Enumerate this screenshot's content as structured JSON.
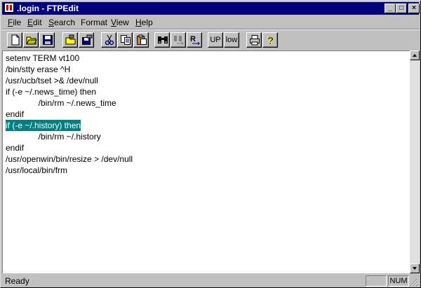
{
  "window": {
    "title": ".login - FTPEdit",
    "controls": {
      "minimize": "_",
      "maximize": "□",
      "close": "×"
    }
  },
  "menu": {
    "items": [
      {
        "accel": "F",
        "rest": "ile"
      },
      {
        "accel": "E",
        "rest": "dit"
      },
      {
        "accel": "S",
        "rest": "earch"
      },
      {
        "accel": "",
        "rest": "Format"
      },
      {
        "accel": "V",
        "rest": "iew"
      },
      {
        "accel": "H",
        "rest": "elp"
      }
    ]
  },
  "toolbar": {
    "icons": [
      "new-file-icon",
      "open-folder-icon",
      "save-disk-icon",
      "ftp-open-icon",
      "ftp-save-icon",
      "cut-icon",
      "copy-icon",
      "paste-icon",
      "find-binoculars-icon",
      "find-next-icon",
      "replace-icon",
      "print-icon",
      "help-icon"
    ],
    "up_label": "UP",
    "low_label": "low"
  },
  "editor": {
    "lines": [
      "setenv TERM vt100",
      "/bin/stty erase ^H",
      "/usr/ucb/tset >& /dev/null",
      "if (-e ~/.news_time) then",
      "              /bin/rm ~/.news_time",
      "endif",
      "if (-e ~/.history) then",
      "              /bin/rm ~/.history",
      "endif",
      "/usr/openwin/bin/resize > /dev/null",
      "/usr/local/bin/frm"
    ],
    "selected_line": 6,
    "selection_color": "#008080"
  },
  "status": {
    "text": "Ready",
    "num": "NUM"
  }
}
